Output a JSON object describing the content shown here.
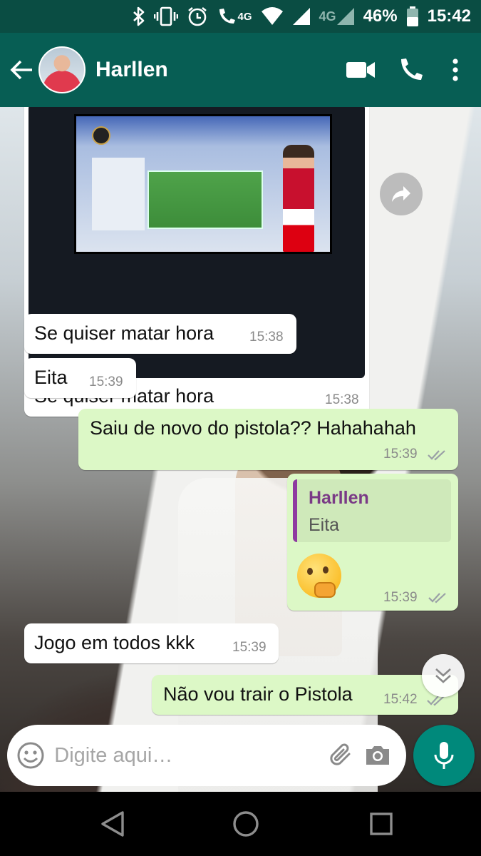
{
  "status_bar": {
    "network_label_1": "4G",
    "network_label_2": "4G",
    "battery": "46%",
    "time": "15:42",
    "icons": [
      "bluetooth-icon",
      "vibrate-icon",
      "alarm-icon",
      "volte-call-icon",
      "wifi-icon",
      "signal-icon",
      "battery-icon"
    ]
  },
  "header": {
    "contact_name": "Harllen",
    "icons": [
      "back-arrow-icon",
      "video-call-icon",
      "phone-icon",
      "more-vert-icon"
    ]
  },
  "messages": [
    {
      "direction": "incoming",
      "type": "image",
      "caption": "Se quiser matar hora",
      "time": "15:38"
    },
    {
      "direction": "incoming",
      "type": "text",
      "text": "Se quiser matar hora",
      "time": "15:38"
    },
    {
      "direction": "incoming",
      "type": "text",
      "text": "Eita",
      "time": "15:39"
    },
    {
      "direction": "outgoing",
      "type": "text",
      "text": "Saiu de novo do pistola?? Hahahahah",
      "time": "15:39",
      "status": "read"
    },
    {
      "direction": "outgoing",
      "type": "reply",
      "quoted_name": "Harllen",
      "quoted_text": "Eita",
      "emoji": "thinking-face",
      "time": "15:39",
      "status": "read"
    },
    {
      "direction": "incoming",
      "type": "text",
      "text": "Jogo em todos kkk",
      "time": "15:39"
    },
    {
      "direction": "outgoing",
      "type": "text",
      "text": "Não vou trair o Pistola",
      "time": "15:42",
      "status": "read"
    }
  ],
  "input": {
    "placeholder": "Digite aqui…",
    "value": ""
  },
  "colors": {
    "status_bar": "#0a4d43",
    "header": "#075e54",
    "outgoing_bubble": "#dcf8c6",
    "incoming_bubble": "#ffffff",
    "mic_button": "#00897b",
    "quote_bar": "#8e3aa0",
    "read_ticks": "#9aa0a6"
  }
}
